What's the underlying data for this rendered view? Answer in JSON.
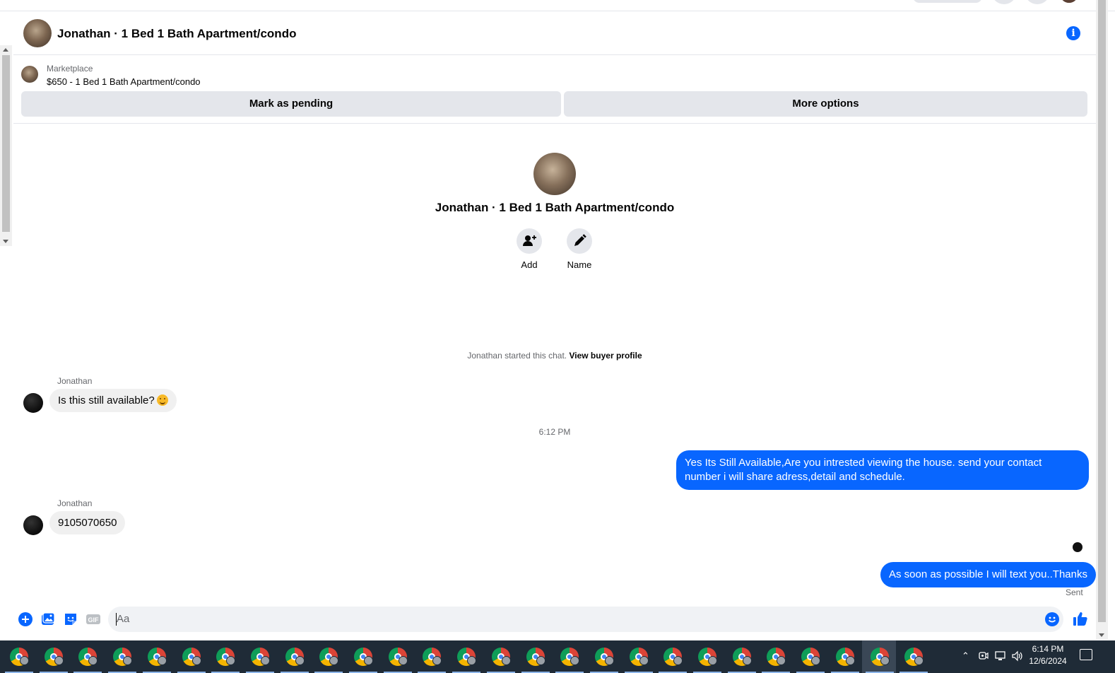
{
  "conversation": {
    "title": "Jonathan · 1 Bed 1 Bath Apartment/condo"
  },
  "listing": {
    "source": "Marketplace",
    "price_title": "$650 - 1 Bed 1 Bath Apartment/condo",
    "mark_pending_label": "Mark as pending",
    "more_options_label": "More options"
  },
  "profile": {
    "name": "Jonathan · 1 Bed 1 Bath Apartment/condo",
    "add_label": "Add",
    "name_label": "Name"
  },
  "chat": {
    "started_text": "Jonathan started this chat.",
    "view_buyer_profile": "View buyer profile",
    "timestamp": "6:12 PM",
    "messages": [
      {
        "sender": "Jonathan",
        "text": "Is this still available?",
        "direction": "incoming",
        "emoji": "smiling-face"
      },
      {
        "sender": "",
        "text": "Yes Its Still Available,Are you intrested viewing the house. send your contact number i will share adress,detail and schedule.",
        "direction": "outgoing"
      },
      {
        "sender": "Jonathan",
        "text": "9105070650",
        "direction": "incoming"
      },
      {
        "sender": "",
        "text": "As soon as possible I will text you..Thanks",
        "direction": "outgoing"
      }
    ],
    "sent_status": "Sent"
  },
  "composer": {
    "placeholder": "Aa",
    "gif_label": "GIF",
    "icons": [
      "plus-icon",
      "image-icon",
      "sticker-icon",
      "gif-icon",
      "emoji-icon",
      "like-icon"
    ]
  },
  "taskbar": {
    "time": "6:14 PM",
    "date": "12/6/2024",
    "app_count": 27
  },
  "colors": {
    "accent": "#0866ff",
    "bubble_incoming": "#f0f0f0",
    "button_bg": "#e4e6eb",
    "taskbar_bg": "#1f2b37"
  }
}
